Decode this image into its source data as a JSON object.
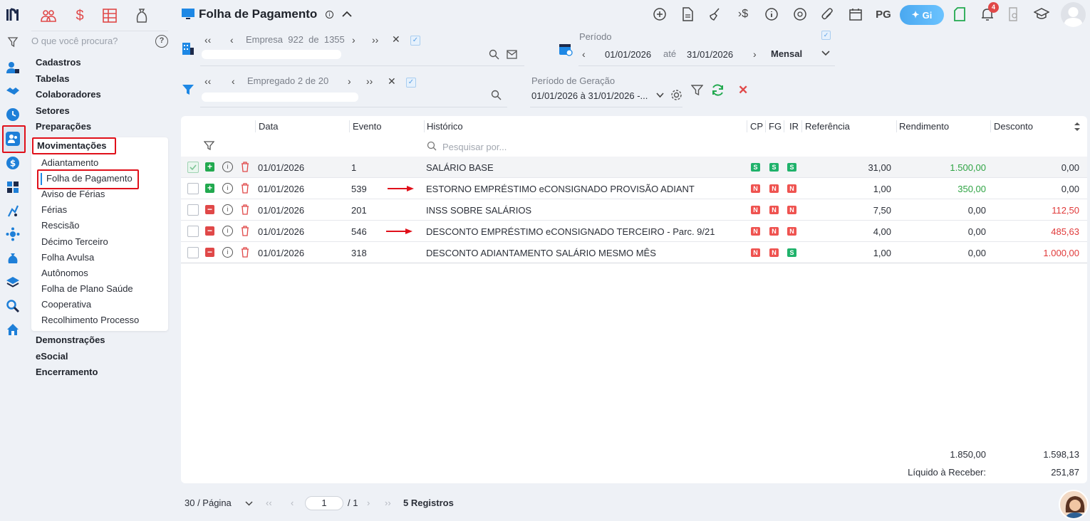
{
  "app": {
    "title": "Folha de Pagamento",
    "gi_label": "Gi",
    "pg_label": "PG",
    "notif_count": "4"
  },
  "search": {
    "placeholder": "O que você procura?"
  },
  "menu": {
    "sections": [
      "Cadastros",
      "Tabelas",
      "Colaboradores",
      "Setores",
      "Preparações"
    ],
    "active_section": "Movimentações",
    "items": [
      "Adiantamento",
      "Folha de Pagamento",
      "Aviso de Férias",
      "Férias",
      "Rescisão",
      "Décimo Terceiro",
      "Folha Avulsa",
      "Autônomos",
      "Folha de Plano Saúde",
      "Cooperativa",
      "Recolhimento Processo"
    ],
    "after": [
      "Demonstrações",
      "eSocial",
      "Encerramento"
    ]
  },
  "filters": {
    "empresa": "Empresa  922  de  1355",
    "empregado": "Empregado 2 de 20",
    "periodo_label": "Período",
    "periodo_inicio": "01/01/2026",
    "ate": "até",
    "periodo_fim": "31/01/2026",
    "tipo": "Mensal",
    "geracao_label": "Período de Geração",
    "geracao_value": "01/01/2026 à 31/01/2026 -..."
  },
  "table": {
    "headers": {
      "data": "Data",
      "evento": "Evento",
      "historico": "Histórico",
      "cp": "CP",
      "fg": "FG",
      "ir": "IR",
      "referencia": "Referência",
      "rendimento": "Rendimento",
      "desconto": "Desconto"
    },
    "search_placeholder": "Pesquisar por...",
    "rows": [
      {
        "data": "01/01/2026",
        "evento": "1",
        "historico": "SALÁRIO BASE",
        "cp": "S",
        "fg": "S",
        "ir": "S",
        "referencia": "31,00",
        "rendimento": "1.500,00",
        "desconto": "0,00"
      },
      {
        "data": "01/01/2026",
        "evento": "539",
        "historico": "ESTORNO EMPRÉSTIMO eCONSIGNADO PROVISÃO ADIANT",
        "cp": "N",
        "fg": "N",
        "ir": "N",
        "referencia": "1,00",
        "rendimento": "350,00",
        "desconto": "0,00"
      },
      {
        "data": "01/01/2026",
        "evento": "201",
        "historico": "INSS SOBRE SALÁRIOS",
        "cp": "N",
        "fg": "N",
        "ir": "N",
        "referencia": "7,50",
        "rendimento": "0,00",
        "desconto": "112,50"
      },
      {
        "data": "01/01/2026",
        "evento": "546",
        "historico": "DESCONTO EMPRÉSTIMO eCONSIGNADO TERCEIRO - Parc. 9/21",
        "cp": "N",
        "fg": "N",
        "ir": "N",
        "referencia": "4,00",
        "rendimento": "0,00",
        "desconto": "485,63"
      },
      {
        "data": "01/01/2026",
        "evento": "318",
        "historico": "DESCONTO ADIANTAMENTO SALÁRIO MESMO MÊS",
        "cp": "N",
        "fg": "N",
        "ir": "S",
        "referencia": "1,00",
        "rendimento": "0,00",
        "desconto": "1.000,00"
      }
    ],
    "total_rendimento": "1.850,00",
    "total_desconto": "1.598,13",
    "liquido_label": "Líquido à Receber:",
    "liquido_value": "251,87"
  },
  "pager": {
    "per_page": "30 / Página",
    "page": "1",
    "of": "/ 1",
    "count": "5 Registros"
  },
  "colors": {
    "accent": "#1e88e5",
    "brand_dark": "#1d2a4a",
    "highlight": "#e0101a"
  }
}
